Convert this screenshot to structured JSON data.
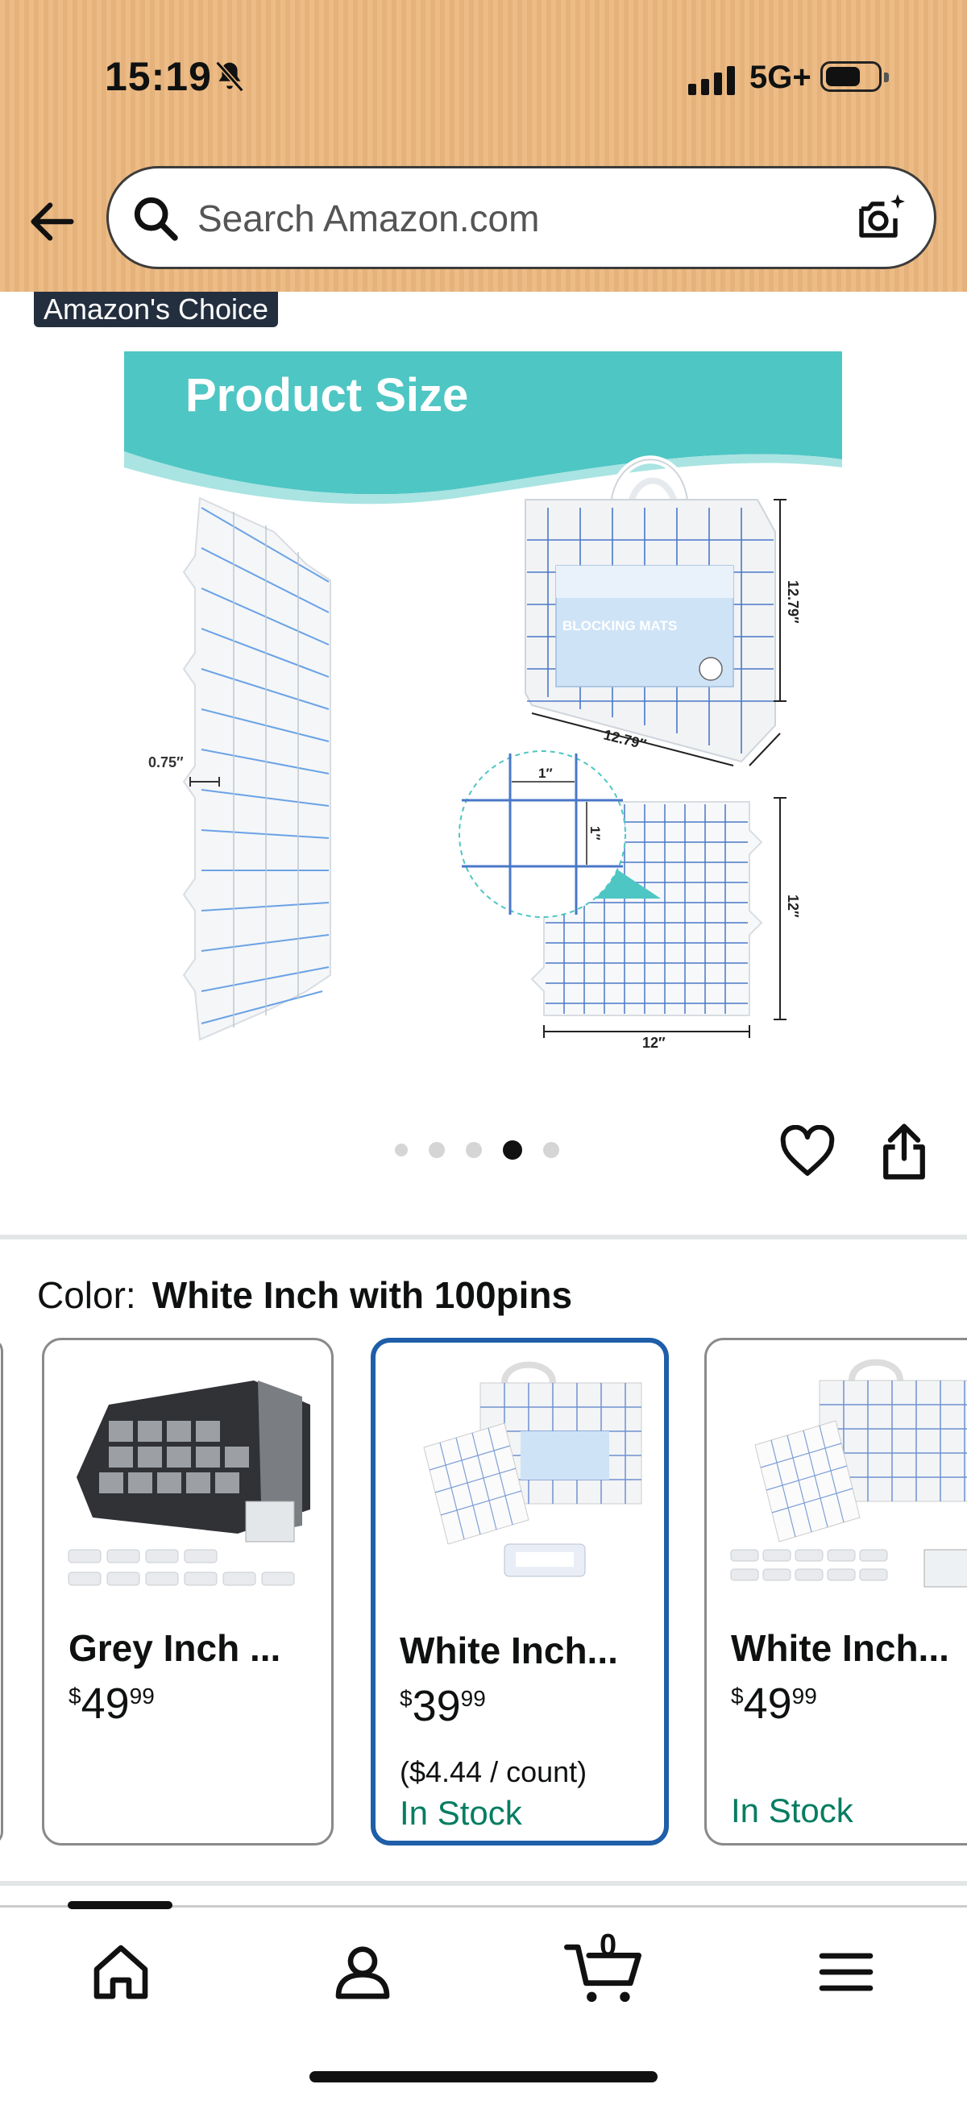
{
  "status_bar": {
    "time": "15:19",
    "network": "5G+"
  },
  "search": {
    "placeholder": "Search Amazon.com"
  },
  "badge": "Amazon's Choice",
  "product_image": {
    "banner": "Product Size",
    "bag_label": "BLOCKING MATS",
    "thickness": "0.75″",
    "bag_height": "12.79″",
    "bag_width": "12.79″",
    "grid_unit_h": "1″",
    "grid_unit_v": "1″",
    "mat_height": "12″",
    "mat_width": "12″"
  },
  "carousel": {
    "count": 5,
    "active_index": 3
  },
  "color": {
    "label": "Color:",
    "value": "White Inch with 100pins"
  },
  "swatches": [
    {
      "name": "Grey Inch ...",
      "dollar": "$",
      "whole": "49",
      "cents": "99",
      "unit": "",
      "stock": ""
    },
    {
      "name": "White Inch...",
      "dollar": "$",
      "whole": "39",
      "cents": "99",
      "unit": "($4.44 / count)",
      "stock": "In Stock"
    },
    {
      "name": "White Inch...",
      "dollar": "$",
      "whole": "49",
      "cents": "99",
      "unit": "",
      "stock": "In Stock"
    }
  ],
  "nav": {
    "cart_count": "0"
  },
  "colors": {
    "header": "#ecb87f",
    "teal": "#4ec6c4",
    "selected_border": "#1f5ea8",
    "stock_green": "#067d62"
  },
  "icons": [
    "bell-slash-icon",
    "signal-icon",
    "battery-icon",
    "back-arrow-icon",
    "search-icon",
    "camera-icon",
    "heart-icon",
    "share-icon",
    "home-icon",
    "account-icon",
    "cart-icon",
    "menu-icon"
  ]
}
